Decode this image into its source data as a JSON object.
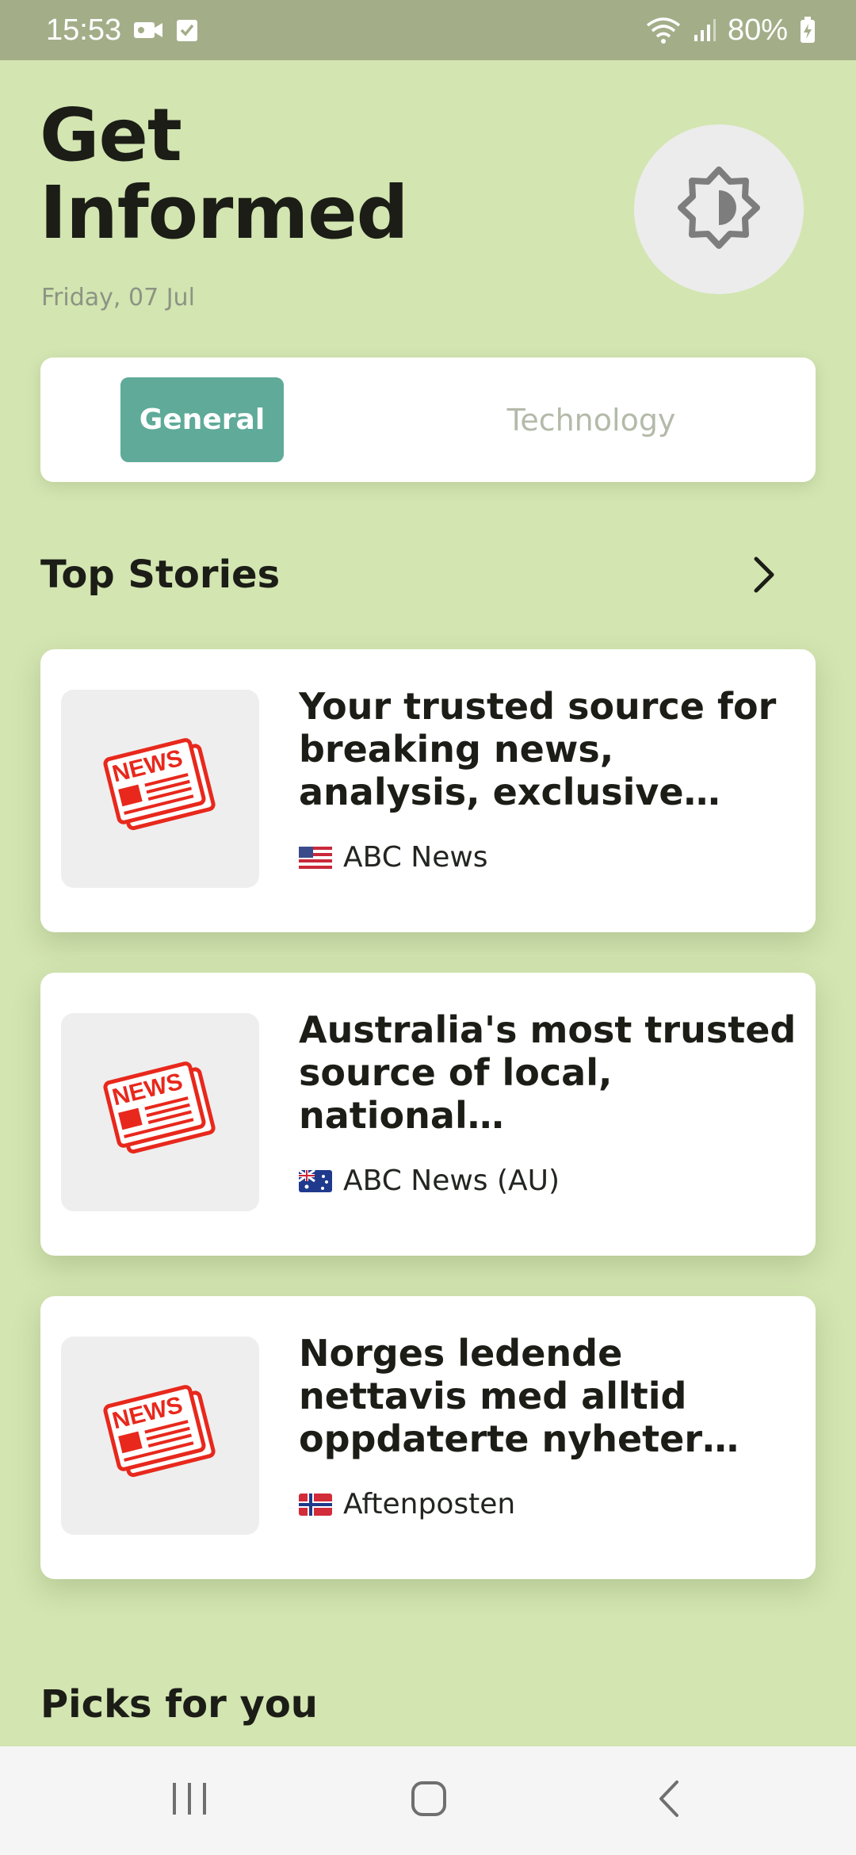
{
  "status_bar": {
    "time": "15:53",
    "battery": "80%"
  },
  "header": {
    "title": "Get Informed",
    "date": "Friday, 07 Jul"
  },
  "tabs": [
    {
      "label": "General",
      "selected": true
    },
    {
      "label": "Technology",
      "selected": false
    }
  ],
  "top_stories": {
    "title": "Top Stories",
    "items": [
      {
        "title": "Your trusted source for breaking news, analysis, exclusive interviews, h…",
        "source": "ABC News",
        "flag": "us-flag-icon"
      },
      {
        "title": "Australia's most trusted source of local, national…",
        "source": "ABC News (AU)",
        "flag": "au-flag-icon"
      },
      {
        "title": "Norges ledende nettavis med alltid oppdaterte nyheter innenfor innenr…",
        "source": "Aftenposten",
        "flag": "no-flag-icon"
      }
    ]
  },
  "picks": {
    "title": "Picks for you"
  },
  "colors": {
    "background": "#d3e5b1",
    "status_bar": "#a3ae89",
    "accent": "#5faa98",
    "news_icon": "#e8281c"
  }
}
